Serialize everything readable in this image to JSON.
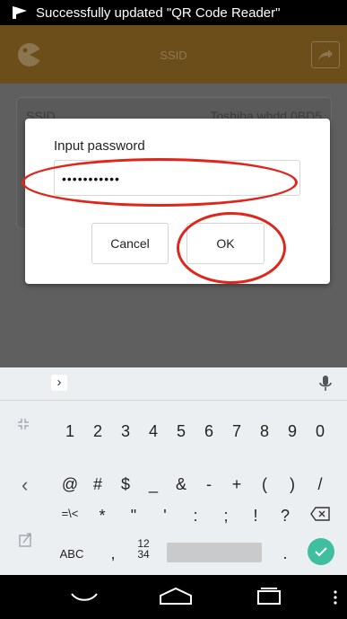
{
  "status_bar": {
    "notification": "Successfully updated \"QR Code Reader\""
  },
  "app_bar": {
    "title": "SSID"
  },
  "background_list": {
    "row_label": "SSID",
    "row_value": "Toshiba whdd 0BD5"
  },
  "dialog": {
    "title": "Input password",
    "password_value": "•••••••••••",
    "cancel_label": "Cancel",
    "ok_label": "OK"
  },
  "keyboard": {
    "row1": [
      "1",
      "2",
      "3",
      "4",
      "5",
      "6",
      "7",
      "8",
      "9",
      "0"
    ],
    "row2": [
      "@",
      "#",
      "$",
      "_",
      "&",
      "-",
      "+",
      "(",
      ")",
      "/"
    ],
    "row3": [
      "=\\<",
      "*",
      "\"",
      "'",
      ":",
      ";",
      "!",
      "?"
    ],
    "abc_label": "ABC",
    "comma": ",",
    "nums_label": "12\n34",
    "period": "."
  },
  "colors": {
    "appbar": "#6b4e1a",
    "annotation": "#e0261b",
    "enter_key": "#3fbfa0"
  },
  "icons": [
    "app-logo-icon",
    "share-icon",
    "mic-icon",
    "back-icon",
    "home-icon",
    "recents-icon",
    "menu-icon"
  ]
}
